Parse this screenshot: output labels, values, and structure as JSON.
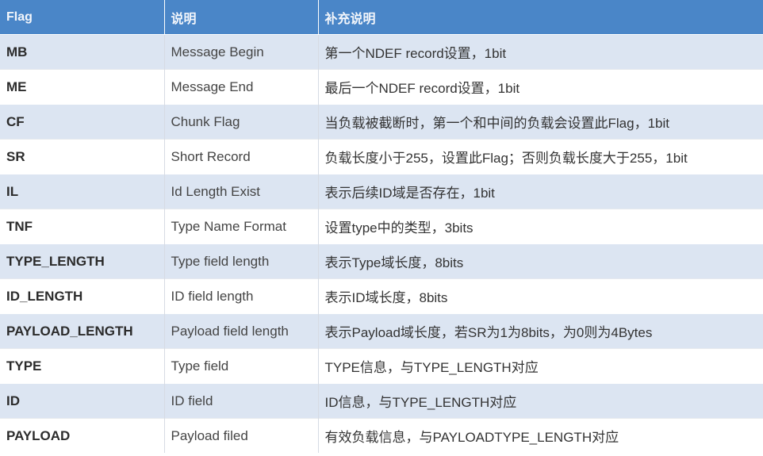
{
  "table": {
    "headers": [
      "Flag",
      "说明",
      "补充说明"
    ],
    "rows": [
      {
        "flag": "MB",
        "desc": "Message Begin",
        "note": "第一个NDEF record设置，1bit"
      },
      {
        "flag": "ME",
        "desc": "Message End",
        "note": "最后一个NDEF record设置，1bit"
      },
      {
        "flag": "CF",
        "desc": "Chunk Flag",
        "note": "当负载被截断时，第一个和中间的负载会设置此Flag，1bit"
      },
      {
        "flag": "SR",
        "desc": "Short Record",
        "note": "负载长度小于255，设置此Flag；否则负载长度大于255，1bit"
      },
      {
        "flag": "IL",
        "desc": "Id Length Exist",
        "note": "表示后续ID域是否存在，1bit"
      },
      {
        "flag": "TNF",
        "desc": "Type Name Format",
        "note": "设置type中的类型，3bits"
      },
      {
        "flag": "TYPE_LENGTH",
        "desc": "Type field length",
        "note": "表示Type域长度，8bits"
      },
      {
        "flag": "ID_LENGTH",
        "desc": "ID field length",
        "note": "表示ID域长度，8bits"
      },
      {
        "flag": "PAYLOAD_LENGTH",
        "desc": "Payload field length",
        "note": "表示Payload域长度，若SR为1为8bits，为0则为4Bytes"
      },
      {
        "flag": "TYPE",
        "desc": "Type field",
        "note": "TYPE信息，与TYPE_LENGTH对应"
      },
      {
        "flag": "ID",
        "desc": "ID field",
        "note": "ID信息，与TYPE_LENGTH对应"
      },
      {
        "flag": "PAYLOAD",
        "desc": "Payload filed",
        "note": "有效负载信息，与PAYLOADTYPE_LENGTH对应"
      }
    ]
  },
  "colors": {
    "header_bg": "#4a86c8",
    "row_stripe": "#dce5f2"
  }
}
